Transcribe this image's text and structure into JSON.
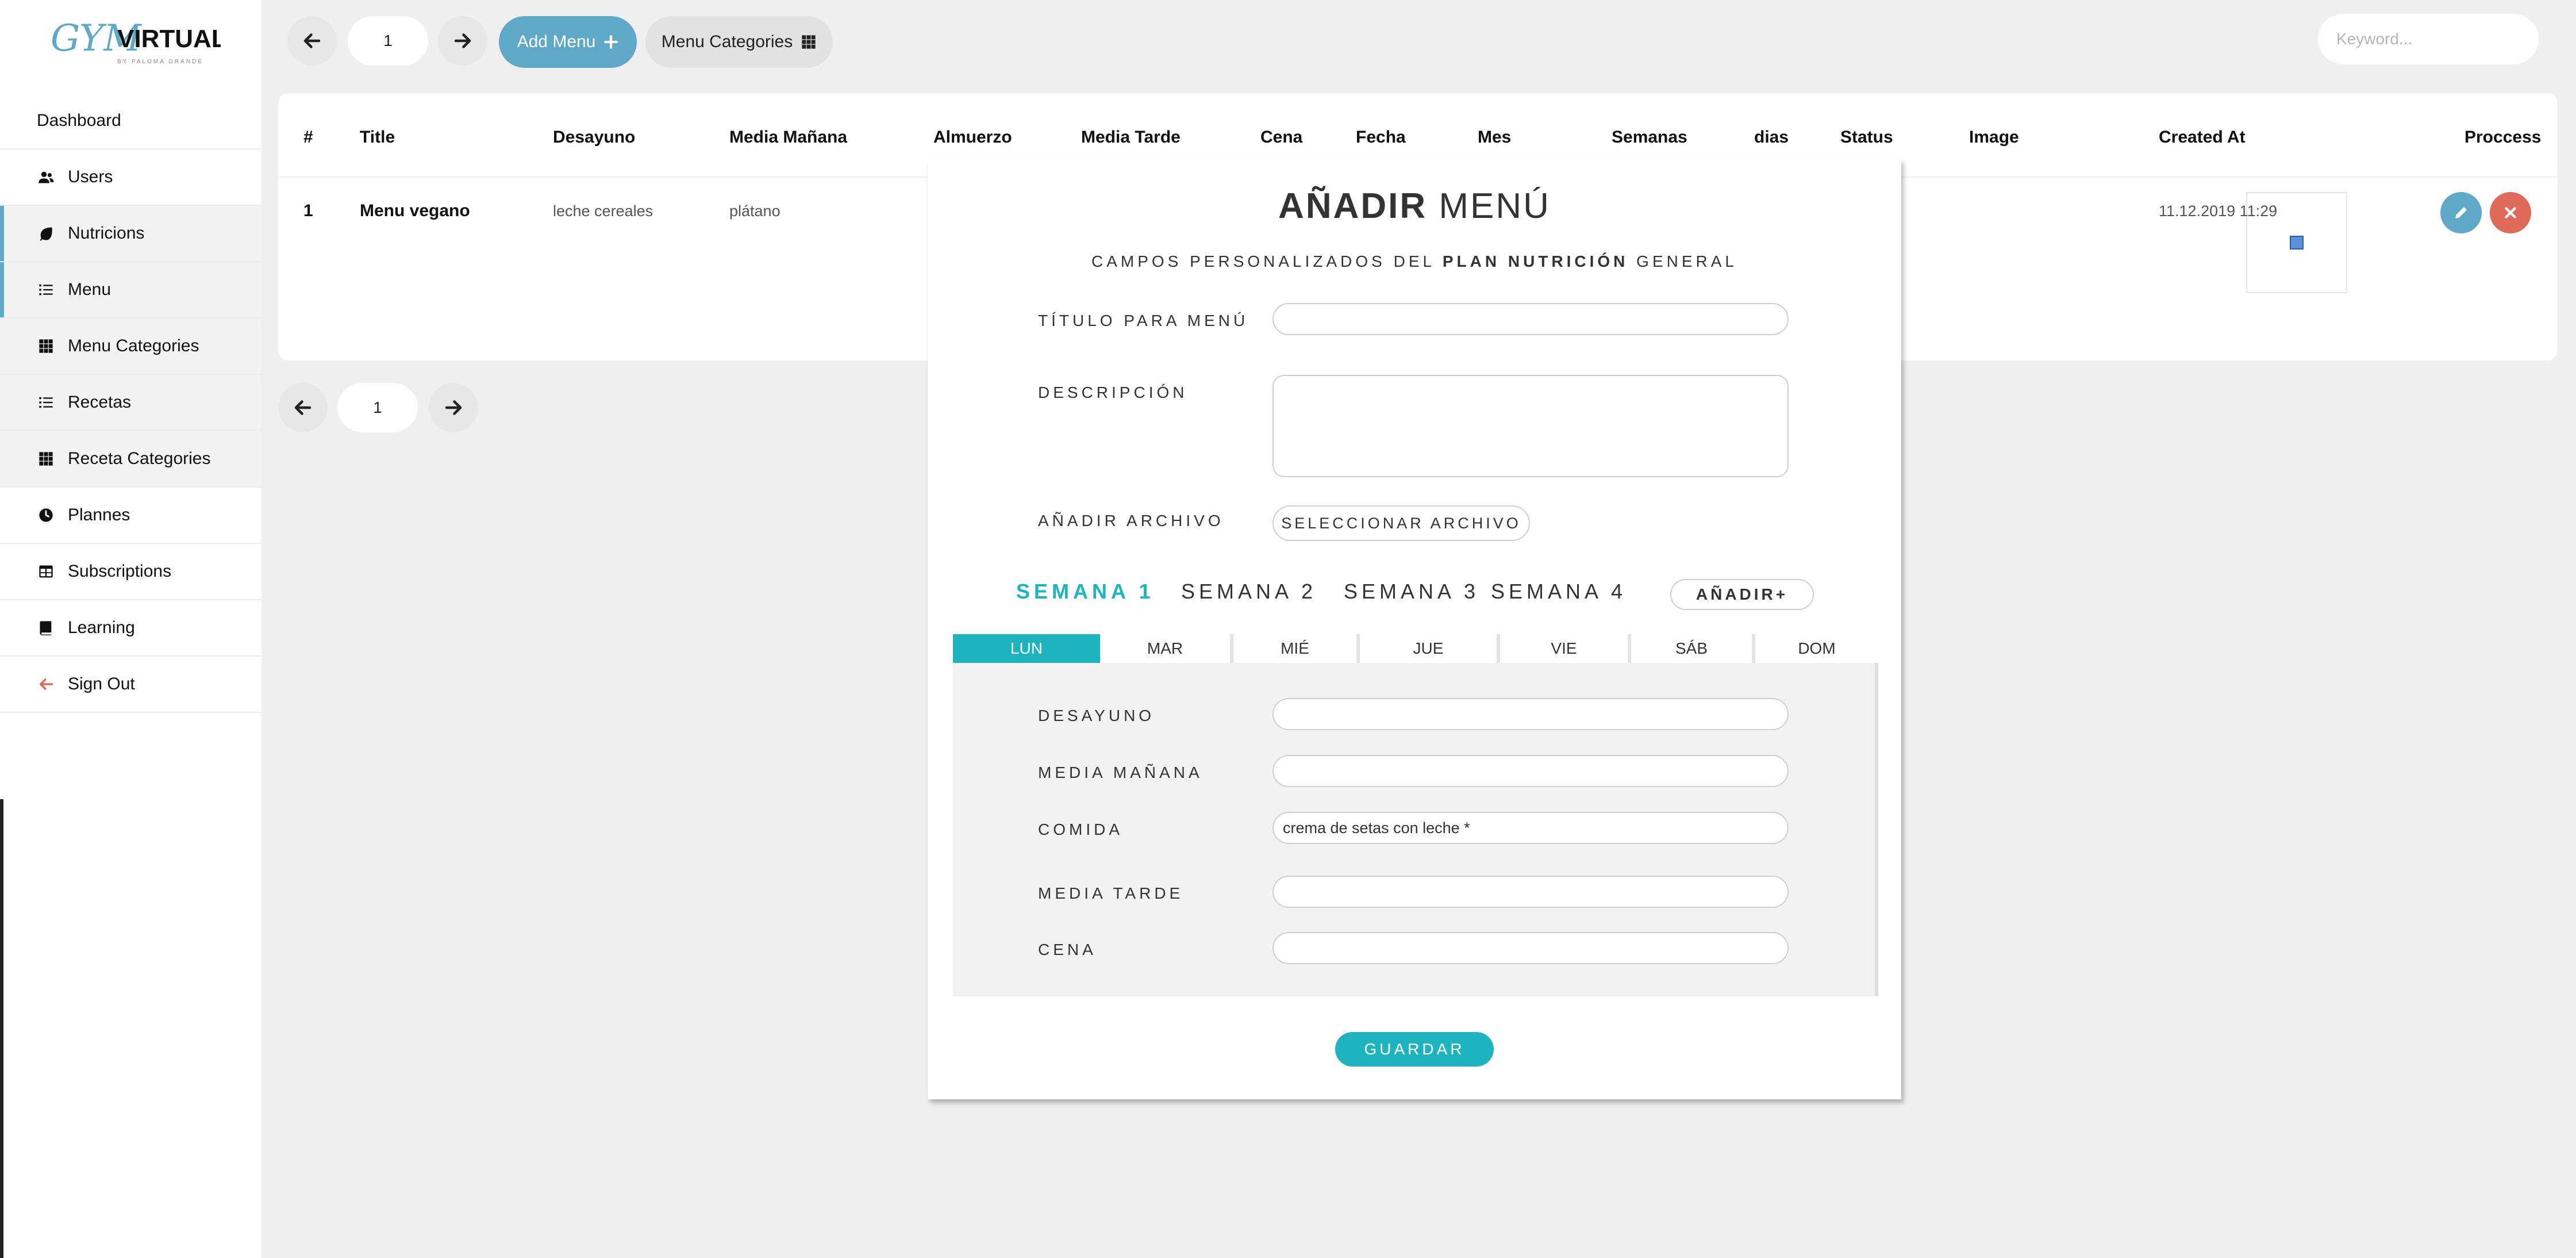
{
  "brand": {
    "logo_main": "GYM",
    "logo_accent": "VIRTUAL",
    "logo_tagline": "BY PALOMA GRANDE",
    "logo_color": "#5fa8c8"
  },
  "sidebar": {
    "items": [
      {
        "label": "Dashboard",
        "icon": "none"
      },
      {
        "label": "Users",
        "icon": "users-icon"
      },
      {
        "label": "Nutricions",
        "icon": "leaf-icon"
      },
      {
        "label": "Menu",
        "icon": "list-icon"
      },
      {
        "label": "Menu Categories",
        "icon": "grid-icon"
      },
      {
        "label": "Recetas",
        "icon": "list-icon"
      },
      {
        "label": "Receta Categories",
        "icon": "grid-icon"
      },
      {
        "label": "Plannes",
        "icon": "clock-icon"
      },
      {
        "label": "Subscriptions",
        "icon": "table-icon"
      },
      {
        "label": "Learning",
        "icon": "book-icon"
      },
      {
        "label": "Sign Out",
        "icon": "arrow-left-icon"
      }
    ]
  },
  "toolbar": {
    "page": "1",
    "add_menu_label": "Add Menu",
    "menu_categories_label": "Menu Categories",
    "search_placeholder": "Keyword..."
  },
  "table": {
    "headers": [
      "#",
      "Title",
      "Desayuno",
      "Media Mañana",
      "Almuerzo",
      "Media Tarde",
      "Cena",
      "Fecha",
      "Mes",
      "Semanas",
      "dias",
      "Status",
      "Image",
      "Created At",
      "Proccess"
    ],
    "rows": [
      {
        "num": "1",
        "title": "Menu vegano",
        "desayuno": "leche cereales",
        "media_manana": "plátano",
        "created_at": "11.12.2019 11:29"
      }
    ]
  },
  "pager_bottom": {
    "page": "1"
  },
  "modal": {
    "title_bold": "AÑADIR",
    "title_light": "MENÚ",
    "subtitle_pre": "CAMPOS PERSONALIZADOS DEL",
    "subtitle_bold": "PLAN NUTRICIÓN",
    "subtitle_post": "GENERAL",
    "title_label": "TÍTULO PARA MENÚ",
    "title_value": "",
    "description_label": "DESCRIPCIÓN",
    "description_value": "",
    "file_label": "AÑADIR ARCHIVO",
    "file_button": "SELECCIONAR ARCHIVO",
    "weeks": [
      "SEMANA 1",
      "SEMANA 2",
      "SEMANA 3",
      "SEMANA 4"
    ],
    "add_week": "AÑADIR+",
    "days": [
      "LUN",
      "MAR",
      "MIÉ",
      "JUE",
      "VIE",
      "SÁB",
      "DOM"
    ],
    "meals": [
      {
        "label": "DESAYUNO",
        "value": ""
      },
      {
        "label": "MEDIA MAÑANA",
        "value": ""
      },
      {
        "label": "COMIDA",
        "value": "crema de setas con leche *"
      },
      {
        "label": "MEDIA TARDE",
        "value": ""
      },
      {
        "label": "CENA",
        "value": ""
      }
    ],
    "save_button": "GUARDAR",
    "accent_color": "#1db4c0"
  }
}
